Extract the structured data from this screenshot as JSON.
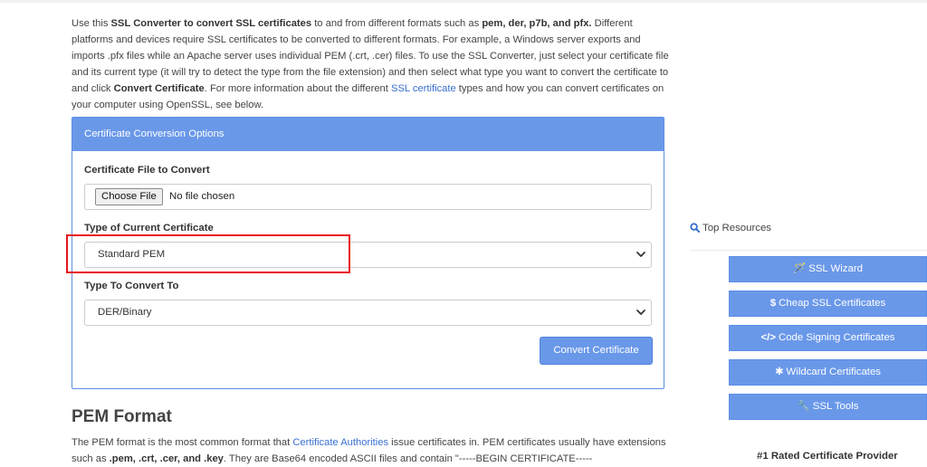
{
  "intro": {
    "p1": "Use this ",
    "b1": "SSL Converter to convert SSL certificates",
    "p2": " to and from different formats such as ",
    "b2": "pem, der, p7b, and pfx.",
    "p3": " Different platforms and devices require SSL certificates to be converted to different formats. For example, a Windows server exports and imports .pfx files while an Apache server uses individual PEM (.crt, .cer) files. To use the SSL Converter, just select your certificate file and its current type (it will try to detect the type from the file extension) and then select what type you want to convert the certificate to and click ",
    "b3": "Convert Certificate",
    "p4": ". For more information about the different ",
    "link": "SSL certificate",
    "p5": " types and how you can convert certificates on your computer using OpenSSL, see below."
  },
  "panel": {
    "heading": "Certificate Conversion Options",
    "file_label": "Certificate File to Convert",
    "file_button": "Choose File",
    "file_status": "No file chosen",
    "current_label": "Type of Current Certificate",
    "current_value": "Standard PEM",
    "convert_label": "Type To Convert To",
    "convert_value": "DER/Binary",
    "submit": "Convert Certificate"
  },
  "pem": {
    "title": "PEM Format",
    "p1": "The PEM format is the most common format that ",
    "link": "Certificate Authorities",
    "p2": " issue certificates in. PEM certificates usually have extensions such as ",
    "b1": ".pem, .crt, .cer, and .key",
    "p3": ". They are Base64 encoded ASCII files and contain \"-----BEGIN CERTIFICATE-----"
  },
  "sidebar": {
    "title": "Top Resources",
    "buttons": [
      {
        "icon": "🪄",
        "label": "SSL Wizard"
      },
      {
        "icon": "$",
        "label": "Cheap SSL Certificates"
      },
      {
        "icon": "</>",
        "label": "Code Signing Certificates"
      },
      {
        "icon": "✱",
        "label": "Wildcard Certificates"
      },
      {
        "icon": "🔧",
        "label": "SSL Tools"
      }
    ],
    "rated": "#1 Rated Certificate Provider"
  },
  "colors": {
    "accent": "#6a98e9",
    "link": "#3a6fd0",
    "highlight": "#e8141d"
  }
}
